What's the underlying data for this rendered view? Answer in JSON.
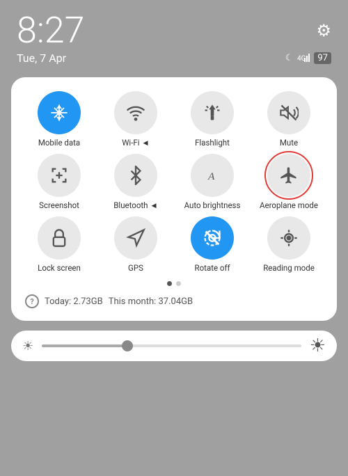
{
  "statusBar": {
    "time": "8:27",
    "date": "Tue, 7 Apr",
    "gearIcon": "⚙",
    "moonIcon": "☾",
    "signalText": "4G",
    "batteryText": "97"
  },
  "tiles": [
    {
      "id": "mobile-data",
      "label": "Mobile data",
      "active": true,
      "icon": "mobile"
    },
    {
      "id": "wifi",
      "label": "Wi-Fi ◄",
      "active": false,
      "icon": "wifi"
    },
    {
      "id": "flashlight",
      "label": "Flashlight",
      "active": false,
      "icon": "flashlight"
    },
    {
      "id": "mute",
      "label": "Mute",
      "active": false,
      "icon": "mute"
    },
    {
      "id": "screenshot",
      "label": "Screenshot",
      "active": false,
      "icon": "screenshot"
    },
    {
      "id": "bluetooth",
      "label": "Bluetooth ◄",
      "active": false,
      "icon": "bluetooth"
    },
    {
      "id": "auto-brightness",
      "label": "Auto brightness",
      "active": false,
      "icon": "brightness"
    },
    {
      "id": "aeroplane-mode",
      "label": "Aeroplane mode",
      "active": false,
      "icon": "aeroplane",
      "highlighted": true
    },
    {
      "id": "lock-screen",
      "label": "Lock screen",
      "active": false,
      "icon": "lock"
    },
    {
      "id": "gps",
      "label": "GPS",
      "active": false,
      "icon": "gps"
    },
    {
      "id": "rotate-off",
      "label": "Rotate off",
      "active": true,
      "icon": "rotate"
    },
    {
      "id": "reading-mode",
      "label": "Reading mode",
      "active": false,
      "icon": "reading"
    }
  ],
  "dots": [
    {
      "active": true
    },
    {
      "active": false
    }
  ],
  "dataUsage": {
    "icon": "?",
    "today": "Today: 2.73GB",
    "thisMonth": "This month: 37.04GB"
  },
  "brightness": {
    "leftIcon": "☀",
    "rightIcon": "☀",
    "value": 35
  }
}
